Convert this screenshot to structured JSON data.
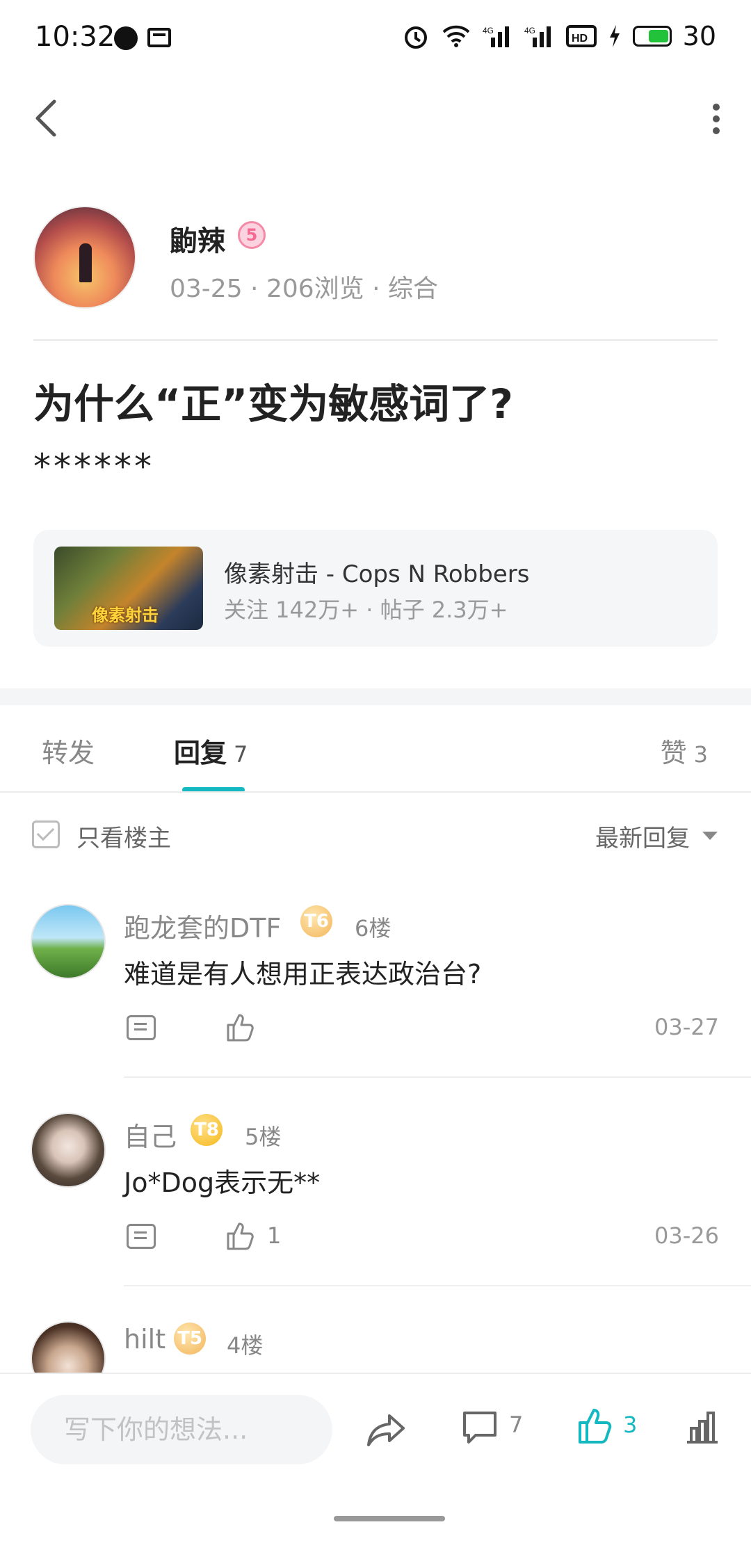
{
  "status_bar": {
    "time": "10:32",
    "battery": "30"
  },
  "author": {
    "name": "鼩辣",
    "level": "5",
    "meta": "03-25 · 206浏览 · 综合"
  },
  "post": {
    "title": "为什么“正”变为敏感词了?",
    "body": "******"
  },
  "game": {
    "name": "像素射击 - Cops N Robbers",
    "stats": "关注 142万+ · 帖子 2.3万+",
    "thumb_label": "像素射击"
  },
  "tabs": {
    "forward": "转发",
    "reply": "回复",
    "reply_count": "7",
    "like": "赞",
    "like_count": "3"
  },
  "filter": {
    "only_op": "只看楼主",
    "sort": "最新回复"
  },
  "comments": [
    {
      "name": "跑龙套的DTF",
      "level": "T6",
      "floor": "6楼",
      "text": "难道是有人想用正表达政治台?",
      "likes": "",
      "date": "03-27"
    },
    {
      "name": "自己",
      "level": "T8",
      "floor": "5楼",
      "text": "Jo*Dog表示无**",
      "likes": "1",
      "date": "03-26"
    },
    {
      "name": "hilt",
      "level": "T5",
      "floor": "4楼",
      "text": "",
      "likes": "",
      "date": ""
    }
  ],
  "bottom_bar": {
    "compose_placeholder": "写下你的想法...",
    "comment_count": "7",
    "like_count": "3"
  },
  "colors": {
    "accent": "#14b8c0",
    "background": "#ffffff"
  }
}
